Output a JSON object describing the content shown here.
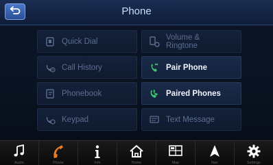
{
  "header": {
    "title": "Phone",
    "back_icon": "back-arrow-icon",
    "accent": "#3d6cc0"
  },
  "menu": {
    "items": [
      {
        "label": "Quick Dial",
        "icon": "quick-dial-icon",
        "enabled": false
      },
      {
        "label": "Volume &\nRingtone",
        "icon": "volume-ringtone-icon",
        "enabled": false
      },
      {
        "label": "Call History",
        "icon": "call-history-icon",
        "enabled": false
      },
      {
        "label": "Pair Phone",
        "icon": "pair-phone-icon",
        "enabled": true
      },
      {
        "label": "Phonebook",
        "icon": "phonebook-icon",
        "enabled": false
      },
      {
        "label": "Paired Phones",
        "icon": "paired-phones-icon",
        "enabled": true
      },
      {
        "label": "Keypad",
        "icon": "keypad-icon",
        "enabled": false
      },
      {
        "label": "Text Message",
        "icon": "text-message-icon",
        "enabled": false
      }
    ],
    "active_color": "#f2f6ff",
    "disabled_color": "#5b6e90",
    "phone_icon_color": "#3ec46a"
  },
  "bottom_bar": {
    "buttons": [
      {
        "icon": "music-note-icon",
        "label": "Audio"
      },
      {
        "icon": "phone-handset-icon",
        "label": "Phone"
      },
      {
        "icon": "info-icon",
        "label": "Info"
      },
      {
        "icon": "home-icon",
        "label": "Home"
      },
      {
        "icon": "map-icon",
        "label": "Map"
      },
      {
        "icon": "navigation-arrow-icon",
        "label": "Nav"
      },
      {
        "icon": "settings-gear-icon",
        "label": "Settings"
      }
    ],
    "active_color": "#f07a1e"
  }
}
